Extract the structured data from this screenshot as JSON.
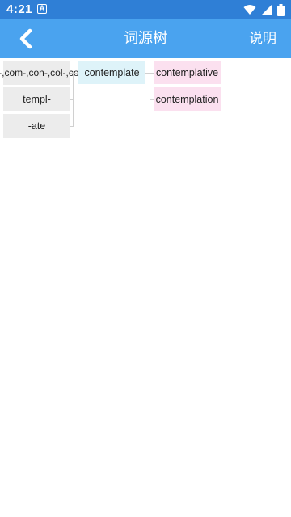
{
  "status_bar": {
    "time": "4:21",
    "notification_icon": "a-icon",
    "icons": [
      "wifi-icon",
      "signal-icon",
      "battery-icon"
    ]
  },
  "app_bar": {
    "back_icon": "chevron-left-icon",
    "title": "词源树",
    "help_label": "说明"
  },
  "tree": {
    "roots": [
      {
        "label": "co-,com-,con-,col-,cor-"
      },
      {
        "label": "templ-"
      },
      {
        "label": "-ate"
      }
    ],
    "word": {
      "label": "contemplate"
    },
    "derived": [
      {
        "label": "contemplative"
      },
      {
        "label": "contemplation"
      }
    ]
  },
  "colors": {
    "status_bar": "#2f7fd6",
    "app_bar": "#4aa3ef",
    "root_node": "#ececec",
    "word_node": "#def3f9",
    "derived_node": "#fbe0ef"
  }
}
